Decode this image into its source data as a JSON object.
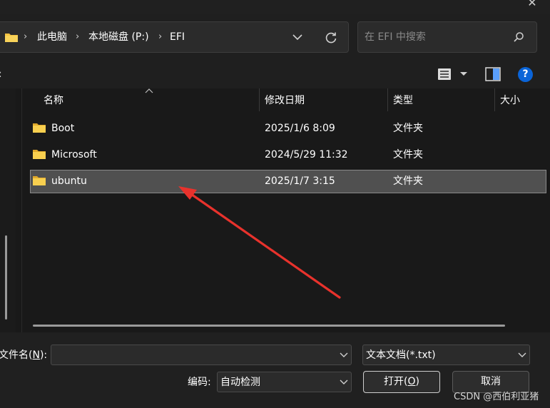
{
  "window": {
    "close_glyph": "✕"
  },
  "address": {
    "crumbs": [
      "此电脑",
      "本地磁盘 (P:)",
      "EFI"
    ],
    "separator": "›"
  },
  "search": {
    "placeholder": "在 EFI 中搜索"
  },
  "toolbar": {
    "left_glyph": ":",
    "view_icon": "list-view-icon",
    "preview_icon": "preview-pane-icon",
    "help_label": "?"
  },
  "columns": {
    "name": "名称",
    "date": "修改日期",
    "type": "类型",
    "size": "大小"
  },
  "files": [
    {
      "name": "Boot",
      "date": "2025/1/6 8:09",
      "type": "文件夹",
      "selected": false
    },
    {
      "name": "Microsoft",
      "date": "2024/5/29 11:32",
      "type": "文件夹",
      "selected": false
    },
    {
      "name": "ubuntu",
      "date": "2025/1/7 3:15",
      "type": "文件夹",
      "selected": true
    }
  ],
  "bottom": {
    "filename_label": "文件名(N):",
    "filename_label_prefix": "文件名(",
    "filename_label_key": "N",
    "filename_label_suffix": "):",
    "filename_value": "",
    "filetype_value": "文本文档(*.txt)",
    "encoding_label": "编码:",
    "encoding_value": "自动检测",
    "open_label_prefix": "打开(",
    "open_label_key": "O",
    "open_label_suffix": ")",
    "cancel_label": "取消"
  },
  "watermark": "CSDN @西伯利亚猪",
  "colors": {
    "accent_blue": "#0a64d8",
    "folder_yellow": "#f3c242",
    "arrow_red": "#e8322c",
    "selection": "#505050"
  }
}
